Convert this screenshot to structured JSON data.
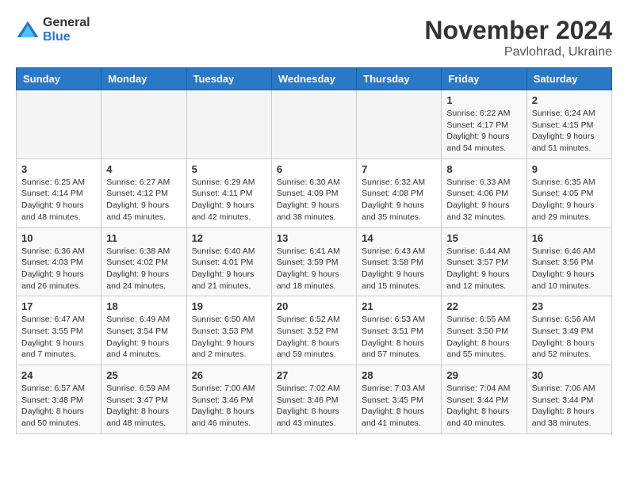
{
  "logo": {
    "general": "General",
    "blue": "Blue"
  },
  "header": {
    "month": "November 2024",
    "location": "Pavlohrad, Ukraine"
  },
  "weekdays": [
    "Sunday",
    "Monday",
    "Tuesday",
    "Wednesday",
    "Thursday",
    "Friday",
    "Saturday"
  ],
  "weeks": [
    [
      {
        "day": "",
        "info": ""
      },
      {
        "day": "",
        "info": ""
      },
      {
        "day": "",
        "info": ""
      },
      {
        "day": "",
        "info": ""
      },
      {
        "day": "",
        "info": ""
      },
      {
        "day": "1",
        "info": "Sunrise: 6:22 AM\nSunset: 4:17 PM\nDaylight: 9 hours\nand 54 minutes."
      },
      {
        "day": "2",
        "info": "Sunrise: 6:24 AM\nSunset: 4:15 PM\nDaylight: 9 hours\nand 51 minutes."
      }
    ],
    [
      {
        "day": "3",
        "info": "Sunrise: 6:25 AM\nSunset: 4:14 PM\nDaylight: 9 hours\nand 48 minutes."
      },
      {
        "day": "4",
        "info": "Sunrise: 6:27 AM\nSunset: 4:12 PM\nDaylight: 9 hours\nand 45 minutes."
      },
      {
        "day": "5",
        "info": "Sunrise: 6:29 AM\nSunset: 4:11 PM\nDaylight: 9 hours\nand 42 minutes."
      },
      {
        "day": "6",
        "info": "Sunrise: 6:30 AM\nSunset: 4:09 PM\nDaylight: 9 hours\nand 38 minutes."
      },
      {
        "day": "7",
        "info": "Sunrise: 6:32 AM\nSunset: 4:08 PM\nDaylight: 9 hours\nand 35 minutes."
      },
      {
        "day": "8",
        "info": "Sunrise: 6:33 AM\nSunset: 4:06 PM\nDaylight: 9 hours\nand 32 minutes."
      },
      {
        "day": "9",
        "info": "Sunrise: 6:35 AM\nSunset: 4:05 PM\nDaylight: 9 hours\nand 29 minutes."
      }
    ],
    [
      {
        "day": "10",
        "info": "Sunrise: 6:36 AM\nSunset: 4:03 PM\nDaylight: 9 hours\nand 26 minutes."
      },
      {
        "day": "11",
        "info": "Sunrise: 6:38 AM\nSunset: 4:02 PM\nDaylight: 9 hours\nand 24 minutes."
      },
      {
        "day": "12",
        "info": "Sunrise: 6:40 AM\nSunset: 4:01 PM\nDaylight: 9 hours\nand 21 minutes."
      },
      {
        "day": "13",
        "info": "Sunrise: 6:41 AM\nSunset: 3:59 PM\nDaylight: 9 hours\nand 18 minutes."
      },
      {
        "day": "14",
        "info": "Sunrise: 6:43 AM\nSunset: 3:58 PM\nDaylight: 9 hours\nand 15 minutes."
      },
      {
        "day": "15",
        "info": "Sunrise: 6:44 AM\nSunset: 3:57 PM\nDaylight: 9 hours\nand 12 minutes."
      },
      {
        "day": "16",
        "info": "Sunrise: 6:46 AM\nSunset: 3:56 PM\nDaylight: 9 hours\nand 10 minutes."
      }
    ],
    [
      {
        "day": "17",
        "info": "Sunrise: 6:47 AM\nSunset: 3:55 PM\nDaylight: 9 hours\nand 7 minutes."
      },
      {
        "day": "18",
        "info": "Sunrise: 6:49 AM\nSunset: 3:54 PM\nDaylight: 9 hours\nand 4 minutes."
      },
      {
        "day": "19",
        "info": "Sunrise: 6:50 AM\nSunset: 3:53 PM\nDaylight: 9 hours\nand 2 minutes."
      },
      {
        "day": "20",
        "info": "Sunrise: 6:52 AM\nSunset: 3:52 PM\nDaylight: 8 hours\nand 59 minutes."
      },
      {
        "day": "21",
        "info": "Sunrise: 6:53 AM\nSunset: 3:51 PM\nDaylight: 8 hours\nand 57 minutes."
      },
      {
        "day": "22",
        "info": "Sunrise: 6:55 AM\nSunset: 3:50 PM\nDaylight: 8 hours\nand 55 minutes."
      },
      {
        "day": "23",
        "info": "Sunrise: 6:56 AM\nSunset: 3:49 PM\nDaylight: 8 hours\nand 52 minutes."
      }
    ],
    [
      {
        "day": "24",
        "info": "Sunrise: 6:57 AM\nSunset: 3:48 PM\nDaylight: 8 hours\nand 50 minutes."
      },
      {
        "day": "25",
        "info": "Sunrise: 6:59 AM\nSunset: 3:47 PM\nDaylight: 8 hours\nand 48 minutes."
      },
      {
        "day": "26",
        "info": "Sunrise: 7:00 AM\nSunset: 3:46 PM\nDaylight: 8 hours\nand 46 minutes."
      },
      {
        "day": "27",
        "info": "Sunrise: 7:02 AM\nSunset: 3:46 PM\nDaylight: 8 hours\nand 43 minutes."
      },
      {
        "day": "28",
        "info": "Sunrise: 7:03 AM\nSunset: 3:45 PM\nDaylight: 8 hours\nand 41 minutes."
      },
      {
        "day": "29",
        "info": "Sunrise: 7:04 AM\nSunset: 3:44 PM\nDaylight: 8 hours\nand 40 minutes."
      },
      {
        "day": "30",
        "info": "Sunrise: 7:06 AM\nSunset: 3:44 PM\nDaylight: 8 hours\nand 38 minutes."
      }
    ]
  ]
}
